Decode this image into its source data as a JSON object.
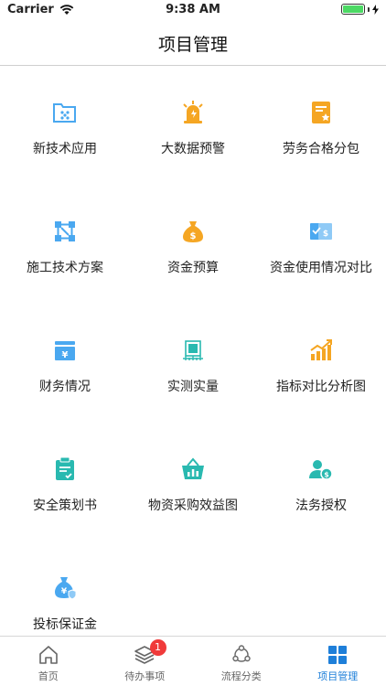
{
  "status_bar": {
    "carrier": "Carrier",
    "time": "9:38 AM"
  },
  "nav": {
    "title": "项目管理"
  },
  "grid_items": [
    {
      "label": "新技术应用",
      "icon": "folder-icon"
    },
    {
      "label": "大数据预警",
      "icon": "alarm-light-icon"
    },
    {
      "label": "劳务合格分包",
      "icon": "certificate-icon"
    },
    {
      "label": "施工技术方案",
      "icon": "network-icon"
    },
    {
      "label": "资金预算",
      "icon": "money-bag-icon"
    },
    {
      "label": "资金使用情况对比",
      "icon": "card-compare-icon"
    },
    {
      "label": "财务情况",
      "icon": "finance-box-icon"
    },
    {
      "label": "实测实量",
      "icon": "measure-chip-icon"
    },
    {
      "label": "指标对比分析图",
      "icon": "bar-chart-icon"
    },
    {
      "label": "安全策划书",
      "icon": "clipboard-icon"
    },
    {
      "label": "物资采购效益图",
      "icon": "basket-icon"
    },
    {
      "label": "法务授权",
      "icon": "user-money-icon"
    },
    {
      "label": "投标保证金",
      "icon": "money-sack-icon"
    }
  ],
  "tabs": [
    {
      "label": "首页",
      "icon": "home-icon"
    },
    {
      "label": "待办事项",
      "icon": "layers-icon",
      "badge": "1"
    },
    {
      "label": "流程分类",
      "icon": "share-icon"
    },
    {
      "label": "项目管理",
      "icon": "grid-icon"
    }
  ],
  "colors": {
    "primary": "#1e7fd9",
    "accent_blue": "#4aa8f0",
    "accent_orange": "#f5a623",
    "accent_teal": "#29b9b0",
    "badge": "#f03a3a"
  }
}
